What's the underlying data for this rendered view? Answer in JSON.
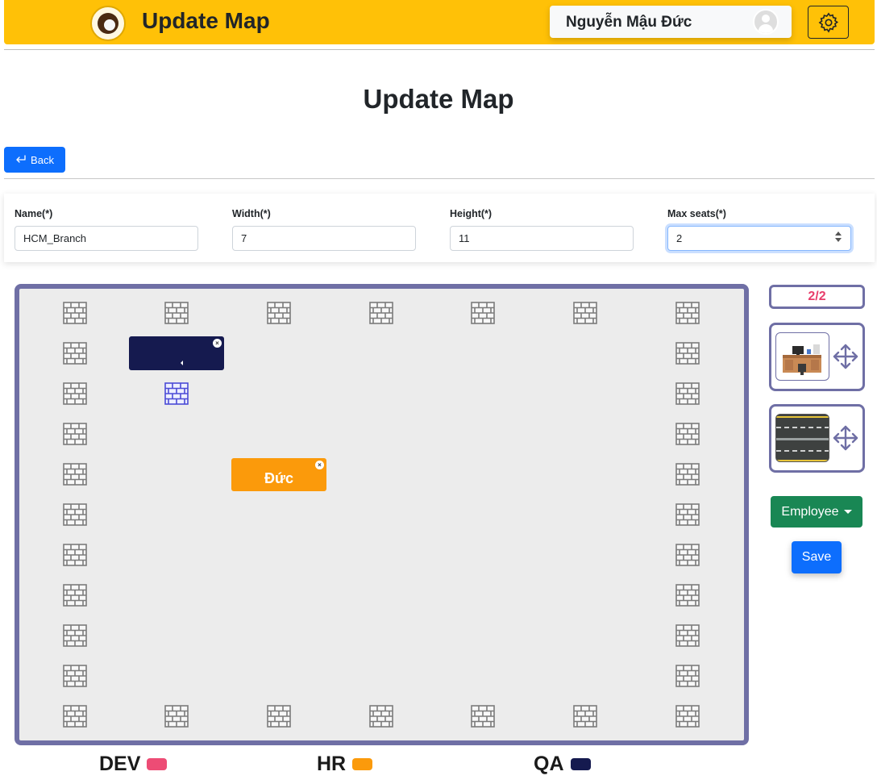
{
  "header": {
    "title": "Update Map",
    "user_name": "Nguyễn Mậu Đức"
  },
  "page": {
    "title": "Update Map",
    "back_label": "Back"
  },
  "form": {
    "name": {
      "label": "Name(*)",
      "value": "HCM_Branch"
    },
    "width": {
      "label": "Width(*)",
      "value": "7"
    },
    "height": {
      "label": "Height(*)",
      "value": "11"
    },
    "max_seats": {
      "label": "Max seats(*)",
      "value": "2"
    }
  },
  "map": {
    "columns": 7,
    "rows": 11,
    "seats": [
      {
        "team": "QA",
        "label": "",
        "color": "#151a4f"
      },
      {
        "team": "HR",
        "label": "Đức",
        "color": "#fb9a0b"
      }
    ]
  },
  "panel": {
    "seat_counter": "2/2",
    "tools": [
      {
        "name": "desk",
        "icon": "desk-icon"
      },
      {
        "name": "road",
        "icon": "road-icon"
      }
    ],
    "employee_label": "Employee",
    "save_label": "Save"
  },
  "legend": [
    {
      "label": "DEV",
      "color": "#ed4c75"
    },
    {
      "label": "HR",
      "color": "#fb9a0b"
    },
    {
      "label": "QA",
      "color": "#151a4f"
    }
  ]
}
